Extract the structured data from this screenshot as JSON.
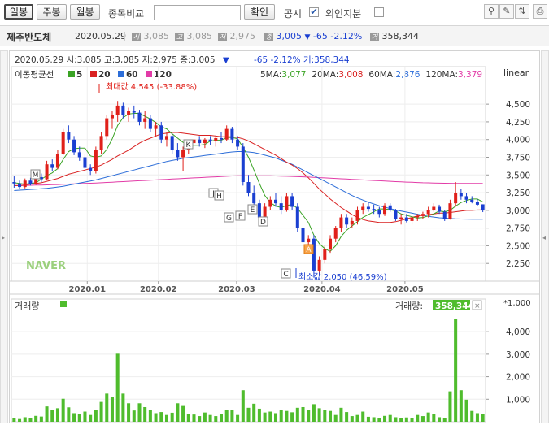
{
  "toolbar": {
    "daily": "일봉",
    "weekly": "주봉",
    "monthly": "월봉",
    "compare_label": "종목비교",
    "compare_value": "",
    "confirm": "확인",
    "disclosure": "공시",
    "foreign": "외인지분"
  },
  "info": {
    "name": "제주반도체",
    "date": "2020.05.29",
    "open_icon": "시",
    "open": "3,085",
    "high_icon": "고",
    "high": "3,085",
    "low_icon": "저",
    "low": "2,975",
    "close_icon": "종",
    "close": "3,005",
    "change": "-65",
    "change_pct": "-2.12%",
    "vol_icon": "거",
    "volume": "358,344",
    "colors": {
      "down": "#1a3fd1",
      "up": "#e0201a"
    }
  },
  "chart_data": [
    {
      "type": "candlestick",
      "header": "2020.05.29 시:3,085 고:3,085 저:2,975 종:3,005",
      "header_change": "-65  -2.12% 거:358,344",
      "scale": "linear",
      "ylim": [
        2000,
        4800
      ],
      "yticks": [
        2250,
        2500,
        2750,
        3000,
        3250,
        3500,
        3750,
        4000,
        4250,
        4500
      ],
      "ytick_labels": [
        "2,250",
        "2,500",
        "2,750",
        "3,000",
        "3,250",
        "3,500",
        "3,750",
        "4,000",
        "4,250",
        "4,500"
      ],
      "xtick_labels": [
        "2020.01",
        "2020.02",
        "2020.03",
        "2020.04",
        "2020.05"
      ],
      "legend_title": "이동평균선",
      "legend": [
        {
          "name": "5",
          "color": "#3aa324"
        },
        {
          "name": "20",
          "color": "#d92121"
        },
        {
          "name": "60",
          "color": "#2c6dd8"
        },
        {
          "name": "120",
          "color": "#e23ba7"
        }
      ],
      "ma_values": [
        {
          "name": "5MA:",
          "value": "3,077",
          "color": "#3aa324"
        },
        {
          "name": "20MA:",
          "value": "3,008",
          "color": "#d92121"
        },
        {
          "name": "60MA:",
          "value": "2,876",
          "color": "#2c6dd8"
        },
        {
          "name": "120MA:",
          "value": "3,379",
          "color": "#e23ba7"
        }
      ],
      "max_label": "최대값 4,545 (-33.88%)",
      "min_label": "최소값 2,050 (46.59%)",
      "markers": [
        "M",
        "K",
        "J",
        "H",
        "G",
        "F",
        "E",
        "D",
        "C",
        "A"
      ],
      "watermark": "NAVER",
      "candles": [
        [
          3400,
          3480,
          3320,
          3380
        ],
        [
          3380,
          3420,
          3300,
          3330
        ],
        [
          3330,
          3450,
          3310,
          3420
        ],
        [
          3420,
          3460,
          3350,
          3370
        ],
        [
          3370,
          3500,
          3360,
          3470
        ],
        [
          3470,
          3520,
          3400,
          3440
        ],
        [
          3440,
          3700,
          3430,
          3650
        ],
        [
          3650,
          3720,
          3550,
          3600
        ],
        [
          3600,
          3850,
          3580,
          3800
        ],
        [
          3800,
          4150,
          3780,
          4100
        ],
        [
          4100,
          4200,
          3950,
          4000
        ],
        [
          4000,
          4050,
          3780,
          3820
        ],
        [
          3820,
          3900,
          3700,
          3750
        ],
        [
          3750,
          3800,
          3550,
          3600
        ],
        [
          3600,
          3650,
          3500,
          3550
        ],
        [
          3550,
          3900,
          3520,
          3850
        ],
        [
          3850,
          4100,
          3800,
          4050
        ],
        [
          4050,
          4350,
          4000,
          4300
        ],
        [
          4300,
          4400,
          4150,
          4350
        ],
        [
          4350,
          4545,
          4250,
          4480
        ],
        [
          4480,
          4520,
          4300,
          4350
        ],
        [
          4350,
          4450,
          4250,
          4400
        ],
        [
          4400,
          4480,
          4300,
          4380
        ],
        [
          4380,
          4420,
          4200,
          4250
        ],
        [
          4250,
          4400,
          4150,
          4300
        ],
        [
          4300,
          4350,
          4100,
          4150
        ],
        [
          4150,
          4250,
          4050,
          4200
        ],
        [
          4200,
          4250,
          3950,
          4000
        ],
        [
          4000,
          4100,
          3900,
          4050
        ],
        [
          4050,
          4080,
          3800,
          3850
        ],
        [
          3850,
          3950,
          3700,
          3750
        ],
        [
          3750,
          3900,
          3550,
          3850
        ],
        [
          3850,
          4000,
          3800,
          3950
        ],
        [
          3950,
          4050,
          3880,
          4000
        ],
        [
          4000,
          4050,
          3900,
          3950
        ],
        [
          3950,
          4020,
          3880,
          4000
        ],
        [
          4000,
          4050,
          3920,
          3980
        ],
        [
          3980,
          4060,
          3900,
          4020
        ],
        [
          4020,
          4100,
          3950,
          4000
        ],
        [
          4000,
          4200,
          3980,
          4150
        ],
        [
          4150,
          4180,
          3950,
          4000
        ],
        [
          4000,
          4050,
          3850,
          3900
        ],
        [
          3900,
          3950,
          3350,
          3400
        ],
        [
          3400,
          3500,
          3200,
          3250
        ],
        [
          3250,
          3350,
          3050,
          3100
        ],
        [
          3100,
          3150,
          2850,
          2900
        ],
        [
          2900,
          3100,
          2880,
          3050
        ],
        [
          3050,
          3200,
          3000,
          3150
        ],
        [
          3150,
          3250,
          3050,
          3100
        ],
        [
          3100,
          3200,
          2950,
          3000
        ],
        [
          3000,
          3250,
          2980,
          3200
        ],
        [
          3200,
          3250,
          3000,
          3050
        ],
        [
          3050,
          3100,
          2700,
          2750
        ],
        [
          2750,
          2800,
          2500,
          2550
        ],
        [
          2550,
          2650,
          2400,
          2600
        ],
        [
          2600,
          2650,
          2050,
          2150
        ],
        [
          2150,
          2350,
          2100,
          2300
        ],
        [
          2300,
          2500,
          2250,
          2450
        ],
        [
          2450,
          2650,
          2400,
          2600
        ],
        [
          2600,
          2780,
          2550,
          2750
        ],
        [
          2750,
          2950,
          2700,
          2900
        ],
        [
          2900,
          2950,
          2750,
          2800
        ],
        [
          2800,
          2900,
          2750,
          2850
        ],
        [
          2850,
          3050,
          2800,
          3000
        ],
        [
          3000,
          3100,
          2950,
          3050
        ],
        [
          3050,
          3120,
          2980,
          3020
        ],
        [
          3020,
          3080,
          2950,
          3000
        ],
        [
          3000,
          3050,
          2900,
          2950
        ],
        [
          2950,
          3100,
          2920,
          3070
        ],
        [
          3070,
          3100,
          2980,
          3000
        ],
        [
          3000,
          3020,
          2850,
          2880
        ],
        [
          2880,
          2950,
          2800,
          2900
        ],
        [
          2900,
          2950,
          2830,
          2850
        ],
        [
          2850,
          2920,
          2800,
          2900
        ],
        [
          2900,
          2950,
          2850,
          2920
        ],
        [
          2920,
          2980,
          2880,
          2950
        ],
        [
          2950,
          3050,
          2900,
          3000
        ],
        [
          3000,
          3100,
          2980,
          3050
        ],
        [
          3050,
          3080,
          2950,
          2980
        ],
        [
          2980,
          3000,
          2850,
          2880
        ],
        [
          2880,
          3150,
          2870,
          3100
        ],
        [
          3100,
          3400,
          3050,
          3250
        ],
        [
          3250,
          3300,
          3150,
          3200
        ],
        [
          3200,
          3250,
          3100,
          3150
        ],
        [
          3150,
          3200,
          3100,
          3120
        ],
        [
          3120,
          3160,
          3060,
          3080
        ],
        [
          3085,
          3085,
          2975,
          3005
        ]
      ],
      "ma5": [
        3390,
        3380,
        3370,
        3380,
        3390,
        3440,
        3490,
        3530,
        3590,
        3720,
        3830,
        3870,
        3880,
        3880,
        3770,
        3750,
        3770,
        3860,
        4010,
        4200,
        4310,
        4360,
        4370,
        4370,
        4330,
        4290,
        4240,
        4180,
        4150,
        4080,
        4020,
        3960,
        3920,
        3920,
        3920,
        3930,
        3980,
        3990,
        3990,
        4030,
        4030,
        4010,
        3890,
        3750,
        3570,
        3380,
        3210,
        3110,
        3060,
        3040,
        3070,
        3080,
        3030,
        2930,
        2830,
        2650,
        2530,
        2460,
        2420,
        2500,
        2630,
        2720,
        2780,
        2840,
        2900,
        2940,
        2980,
        3020,
        3020,
        3010,
        2990,
        2950,
        2930,
        2910,
        2890,
        2900,
        2920,
        2950,
        2990,
        2980,
        3000,
        3060,
        3110,
        3140,
        3160,
        3160,
        3120
      ],
      "ma20": [
        3350,
        3350,
        3360,
        3370,
        3380,
        3390,
        3410,
        3430,
        3450,
        3480,
        3510,
        3530,
        3550,
        3570,
        3590,
        3610,
        3640,
        3680,
        3720,
        3770,
        3810,
        3850,
        3900,
        3950,
        3990,
        4020,
        4050,
        4080,
        4090,
        4100,
        4100,
        4090,
        4080,
        4070,
        4060,
        4060,
        4060,
        4050,
        4040,
        4040,
        4040,
        4030,
        4010,
        3980,
        3940,
        3900,
        3860,
        3820,
        3780,
        3730,
        3680,
        3640,
        3590,
        3530,
        3460,
        3380,
        3300,
        3230,
        3160,
        3100,
        3040,
        2990,
        2940,
        2900,
        2870,
        2850,
        2840,
        2830,
        2830,
        2830,
        2840,
        2860,
        2880,
        2900,
        2920,
        2930,
        2940,
        2950,
        2960,
        2960,
        2970,
        2980,
        2990,
        3000,
        3000,
        3005,
        3008
      ],
      "ma60": [
        3280,
        3285,
        3290,
        3295,
        3300,
        3305,
        3310,
        3320,
        3330,
        3340,
        3355,
        3370,
        3385,
        3400,
        3415,
        3430,
        3450,
        3470,
        3490,
        3510,
        3530,
        3550,
        3570,
        3590,
        3610,
        3630,
        3650,
        3670,
        3690,
        3705,
        3720,
        3735,
        3745,
        3755,
        3765,
        3775,
        3785,
        3795,
        3805,
        3815,
        3825,
        3830,
        3830,
        3825,
        3815,
        3800,
        3780,
        3760,
        3740,
        3710,
        3680,
        3650,
        3610,
        3570,
        3530,
        3490,
        3450,
        3410,
        3370,
        3330,
        3290,
        3250,
        3210,
        3175,
        3145,
        3115,
        3090,
        3065,
        3045,
        3025,
        3005,
        2990,
        2975,
        2960,
        2945,
        2930,
        2915,
        2905,
        2895,
        2890,
        2885,
        2880,
        2878,
        2877,
        2876,
        2876,
        2876
      ],
      "ma120": [
        3350,
        3350,
        3352,
        3354,
        3356,
        3358,
        3360,
        3362,
        3365,
        3368,
        3371,
        3374,
        3377,
        3380,
        3383,
        3386,
        3390,
        3394,
        3398,
        3402,
        3406,
        3410,
        3414,
        3418,
        3422,
        3426,
        3430,
        3434,
        3438,
        3442,
        3446,
        3450,
        3454,
        3458,
        3462,
        3466,
        3470,
        3474,
        3478,
        3482,
        3486,
        3488,
        3489,
        3490,
        3490,
        3490,
        3489,
        3488,
        3486,
        3484,
        3482,
        3479,
        3476,
        3473,
        3470,
        3466,
        3462,
        3458,
        3454,
        3450,
        3446,
        3442,
        3438,
        3434,
        3430,
        3426,
        3422,
        3418,
        3414,
        3410,
        3406,
        3402,
        3399,
        3396,
        3393,
        3390,
        3388,
        3386,
        3384,
        3383,
        3382,
        3381,
        3380,
        3380,
        3379,
        3379,
        3379
      ]
    },
    {
      "type": "bar",
      "title": "거래량",
      "last_label": "거래량:",
      "last_value": "358,344",
      "unit": "*1,000",
      "ylim": [
        0,
        4800
      ],
      "yticks": [
        1000,
        2000,
        3000,
        4000
      ],
      "ytick_labels": [
        "1,000",
        "2,000",
        "3,000",
        "4,000"
      ],
      "color": "#4fbc2d",
      "values": [
        150,
        120,
        200,
        180,
        260,
        230,
        680,
        520,
        600,
        1020,
        640,
        380,
        330,
        450,
        300,
        520,
        880,
        1250,
        1100,
        3020,
        1250,
        820,
        500,
        820,
        650,
        520,
        380,
        430,
        300,
        400,
        820,
        700,
        360,
        320,
        250,
        410,
        300,
        250,
        350,
        540,
        520,
        300,
        1400,
        620,
        800,
        580,
        410,
        450,
        380,
        520,
        480,
        420,
        620,
        650,
        540,
        780,
        600,
        520,
        480,
        300,
        620,
        430,
        250,
        300,
        450,
        220,
        200,
        180,
        260,
        300,
        200,
        170,
        190,
        150,
        300,
        250,
        410,
        350,
        200,
        150,
        1350,
        4550,
        1400,
        980,
        480,
        380,
        358
      ]
    }
  ]
}
